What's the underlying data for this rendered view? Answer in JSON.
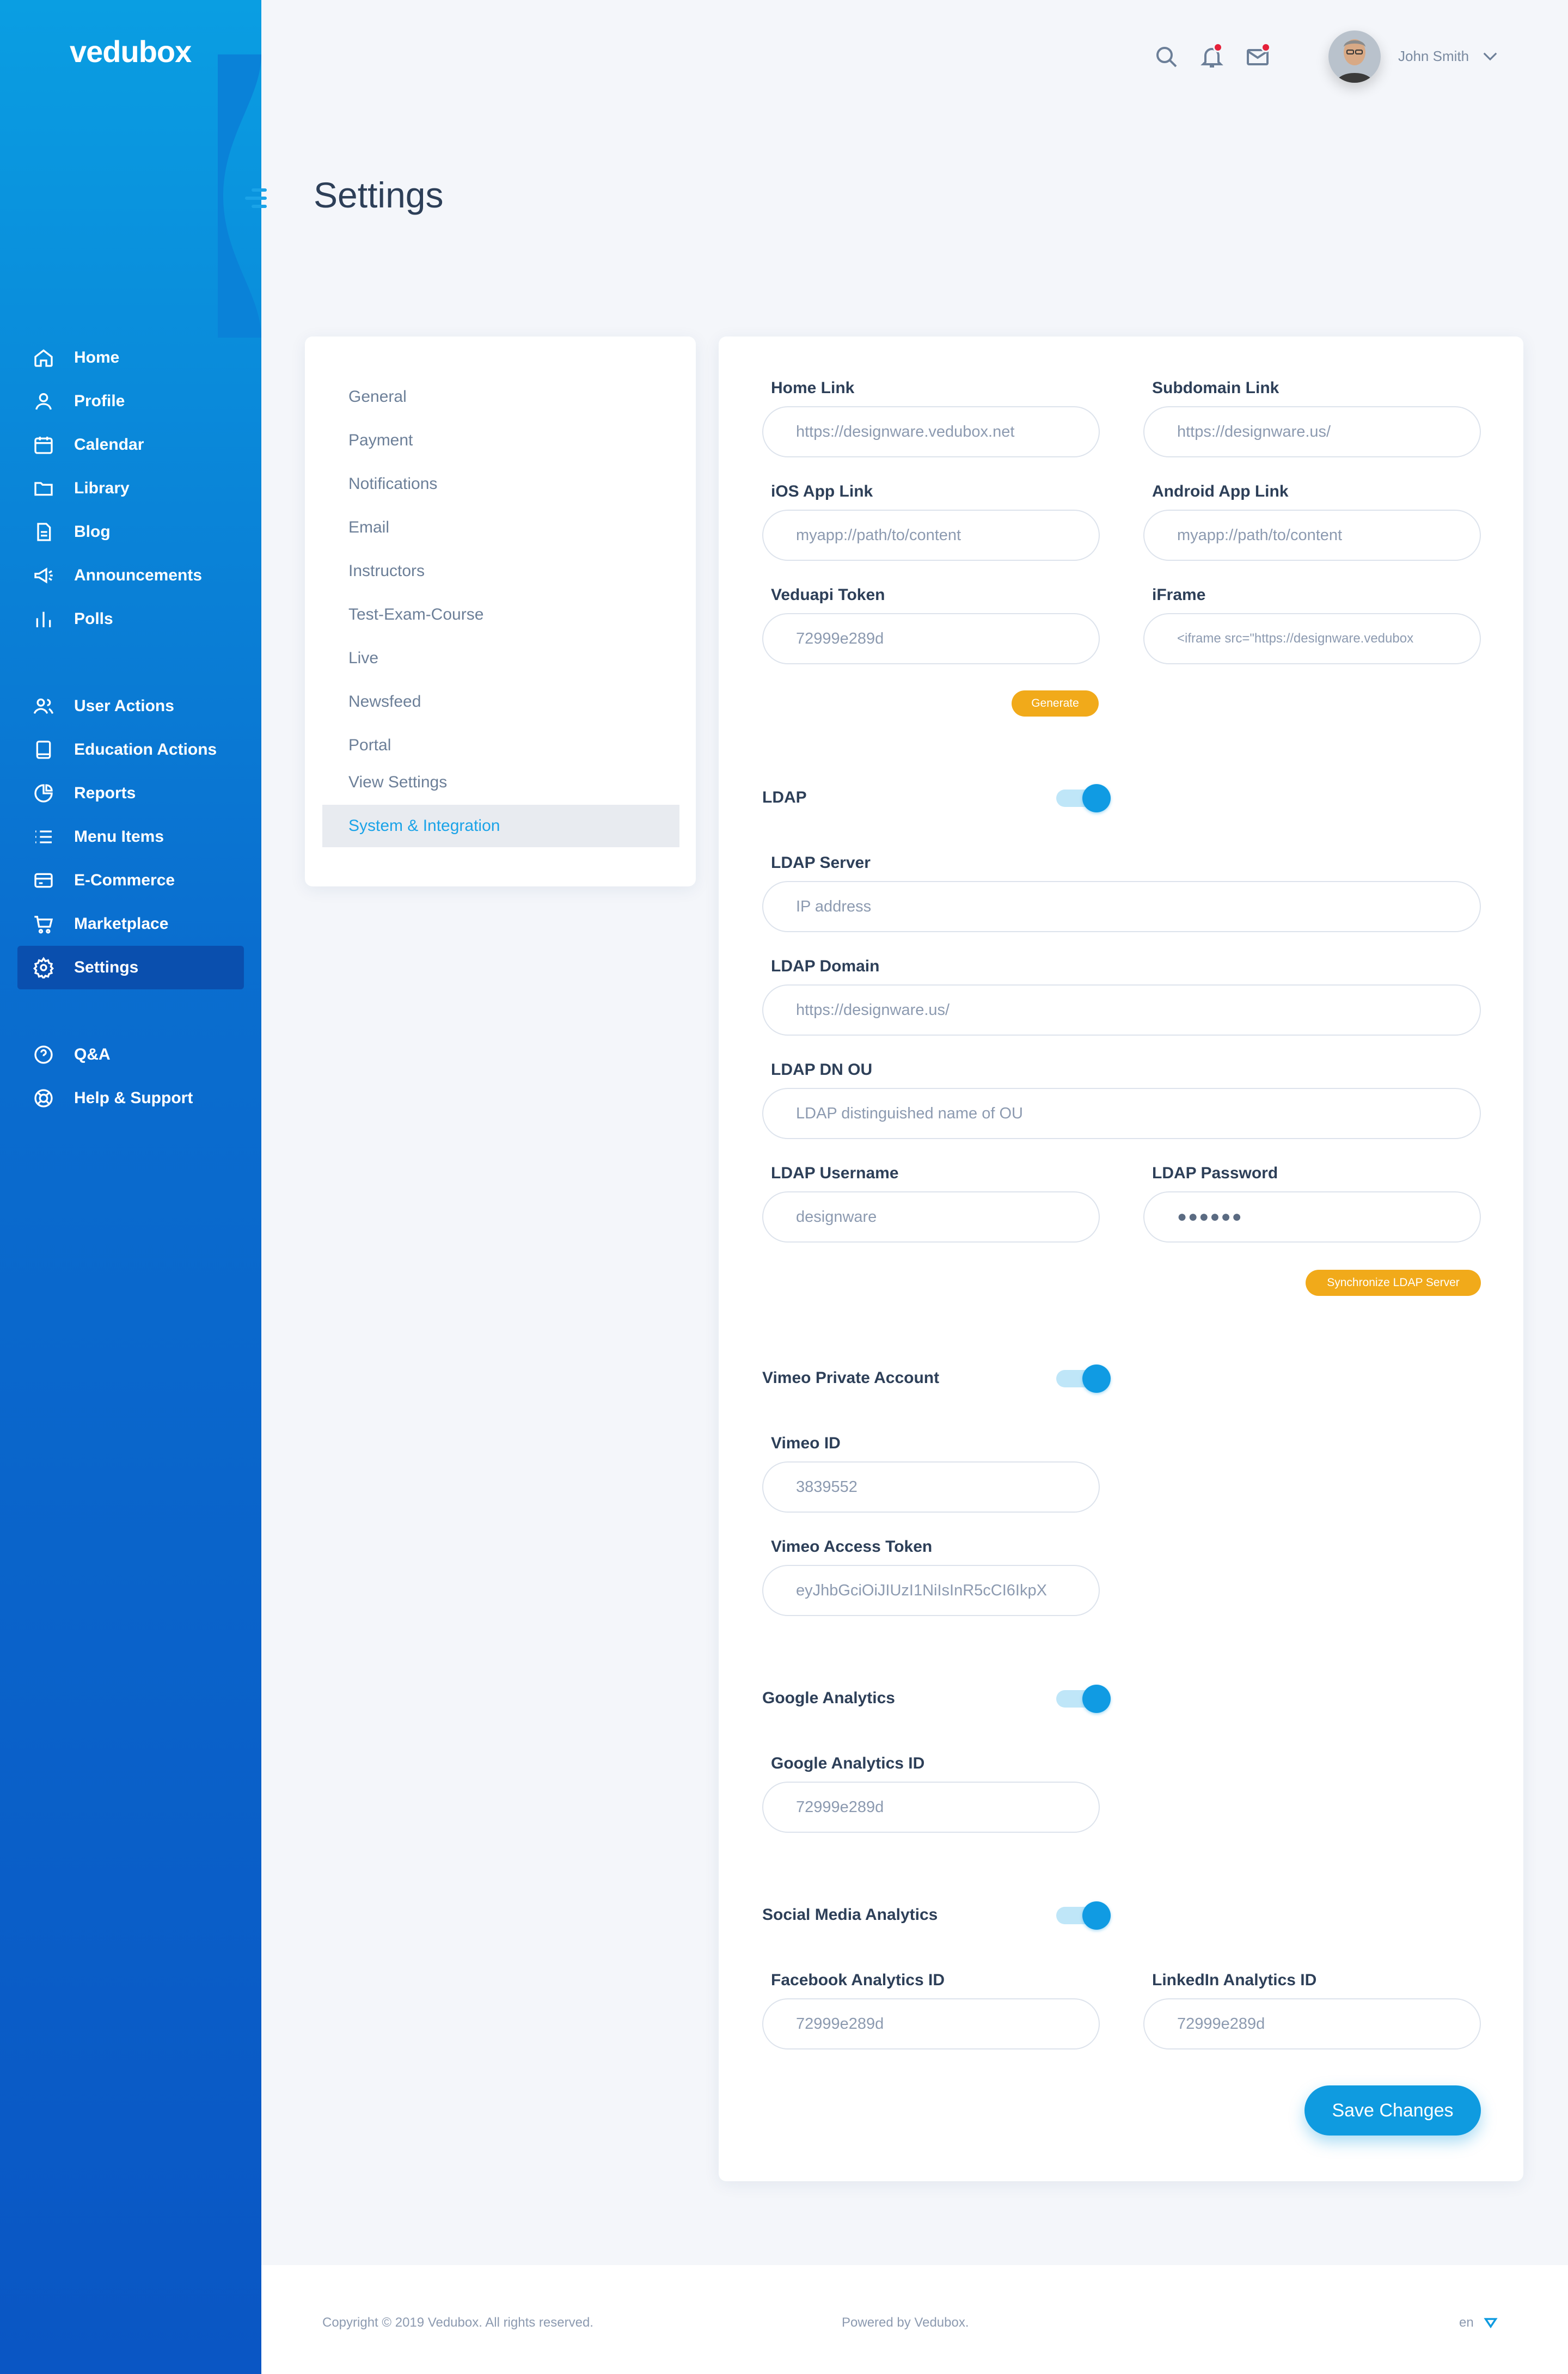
{
  "brand": {
    "logo_text": "vedubox"
  },
  "sidebar": {
    "group1": [
      {
        "label": "Home",
        "icon": "home-icon"
      },
      {
        "label": "Profile",
        "icon": "user-icon"
      },
      {
        "label": "Calendar",
        "icon": "calendar-icon"
      },
      {
        "label": "Library",
        "icon": "folder-icon"
      },
      {
        "label": "Blog",
        "icon": "document-icon"
      },
      {
        "label": "Announcements",
        "icon": "megaphone-icon"
      },
      {
        "label": "Polls",
        "icon": "poll-icon"
      }
    ],
    "group2": [
      {
        "label": "User Actions",
        "icon": "users-icon"
      },
      {
        "label": "Education Actions",
        "icon": "book-icon"
      },
      {
        "label": "Reports",
        "icon": "pie-chart-icon"
      },
      {
        "label": "Menu Items",
        "icon": "list-icon"
      },
      {
        "label": "E-Commerce",
        "icon": "credit-card-icon"
      },
      {
        "label": "Marketplace",
        "icon": "cart-icon"
      },
      {
        "label": "Settings",
        "icon": "gear-icon",
        "active": true
      }
    ],
    "group3": [
      {
        "label": "Q&A",
        "icon": "question-icon"
      },
      {
        "label": "Help & Support",
        "icon": "lifebuoy-icon"
      }
    ]
  },
  "header": {
    "user_name": "John Smith"
  },
  "page": {
    "title": "Settings"
  },
  "settings_menu": {
    "items": [
      "General",
      "Payment",
      "Notifications",
      "Email",
      "Instructors",
      "Test-Exam-Course",
      "Live",
      "Newsfeed",
      "Portal",
      "View Settings",
      "System & Integration"
    ],
    "active": "System & Integration"
  },
  "form": {
    "home_link": {
      "label": "Home Link",
      "value": "https://designware.vedubox.net"
    },
    "subdomain_link": {
      "label": "Subdomain Link",
      "value": "https://designware.us/"
    },
    "ios_app_link": {
      "label": "iOS App Link",
      "value": "myapp://path/to/content"
    },
    "android_app_link": {
      "label": "Android App Link",
      "value": "myapp://path/to/content"
    },
    "veduapi_token": {
      "label": "Veduapi Token",
      "value": "72999e289d"
    },
    "iframe": {
      "label": "iFrame",
      "value": "<iframe src=\"https://designware.vedubox"
    },
    "generate_label": "Generate",
    "ldap": {
      "title": "LDAP",
      "enabled": true,
      "server": {
        "label": "LDAP Server",
        "placeholder": "IP address"
      },
      "domain": {
        "label": "LDAP Domain",
        "value": "https://designware.us/"
      },
      "dn_ou": {
        "label": "LDAP DN OU",
        "placeholder": "LDAP distinguished name of OU"
      },
      "username": {
        "label": "LDAP Username",
        "value": "designware"
      },
      "password": {
        "label": "LDAP Password",
        "value": "●●●●●●"
      },
      "sync_label": "Synchronize LDAP Server"
    },
    "vimeo": {
      "title": "Vimeo Private Account",
      "enabled": true,
      "id": {
        "label": "Vimeo ID",
        "value": "3839552"
      },
      "token": {
        "label": "Vimeo Access Token",
        "value": "eyJhbGciOiJIUzI1NiIsInR5cCI6IkpX"
      }
    },
    "google_analytics": {
      "title": "Google Analytics",
      "enabled": true,
      "id": {
        "label": "Google Analytics ID",
        "value": "72999e289d"
      }
    },
    "social_media": {
      "title": "Social Media Analytics",
      "enabled": true,
      "facebook": {
        "label": "Facebook Analytics ID",
        "value": "72999e289d"
      },
      "linkedin": {
        "label": "LinkedIn Analytics ID",
        "value": "72999e289d"
      }
    },
    "save_label": "Save Changes"
  },
  "footer": {
    "copyright": "Copyright © 2019 Vedubox. All rights reserved.",
    "powered": "Powered by Vedubox.",
    "language": "en"
  },
  "colors": {
    "accent": "#0f9be0",
    "warning": "#f1aa1a",
    "sidebar_top": "#0a9ee2",
    "sidebar_bottom": "#0a56c4"
  }
}
